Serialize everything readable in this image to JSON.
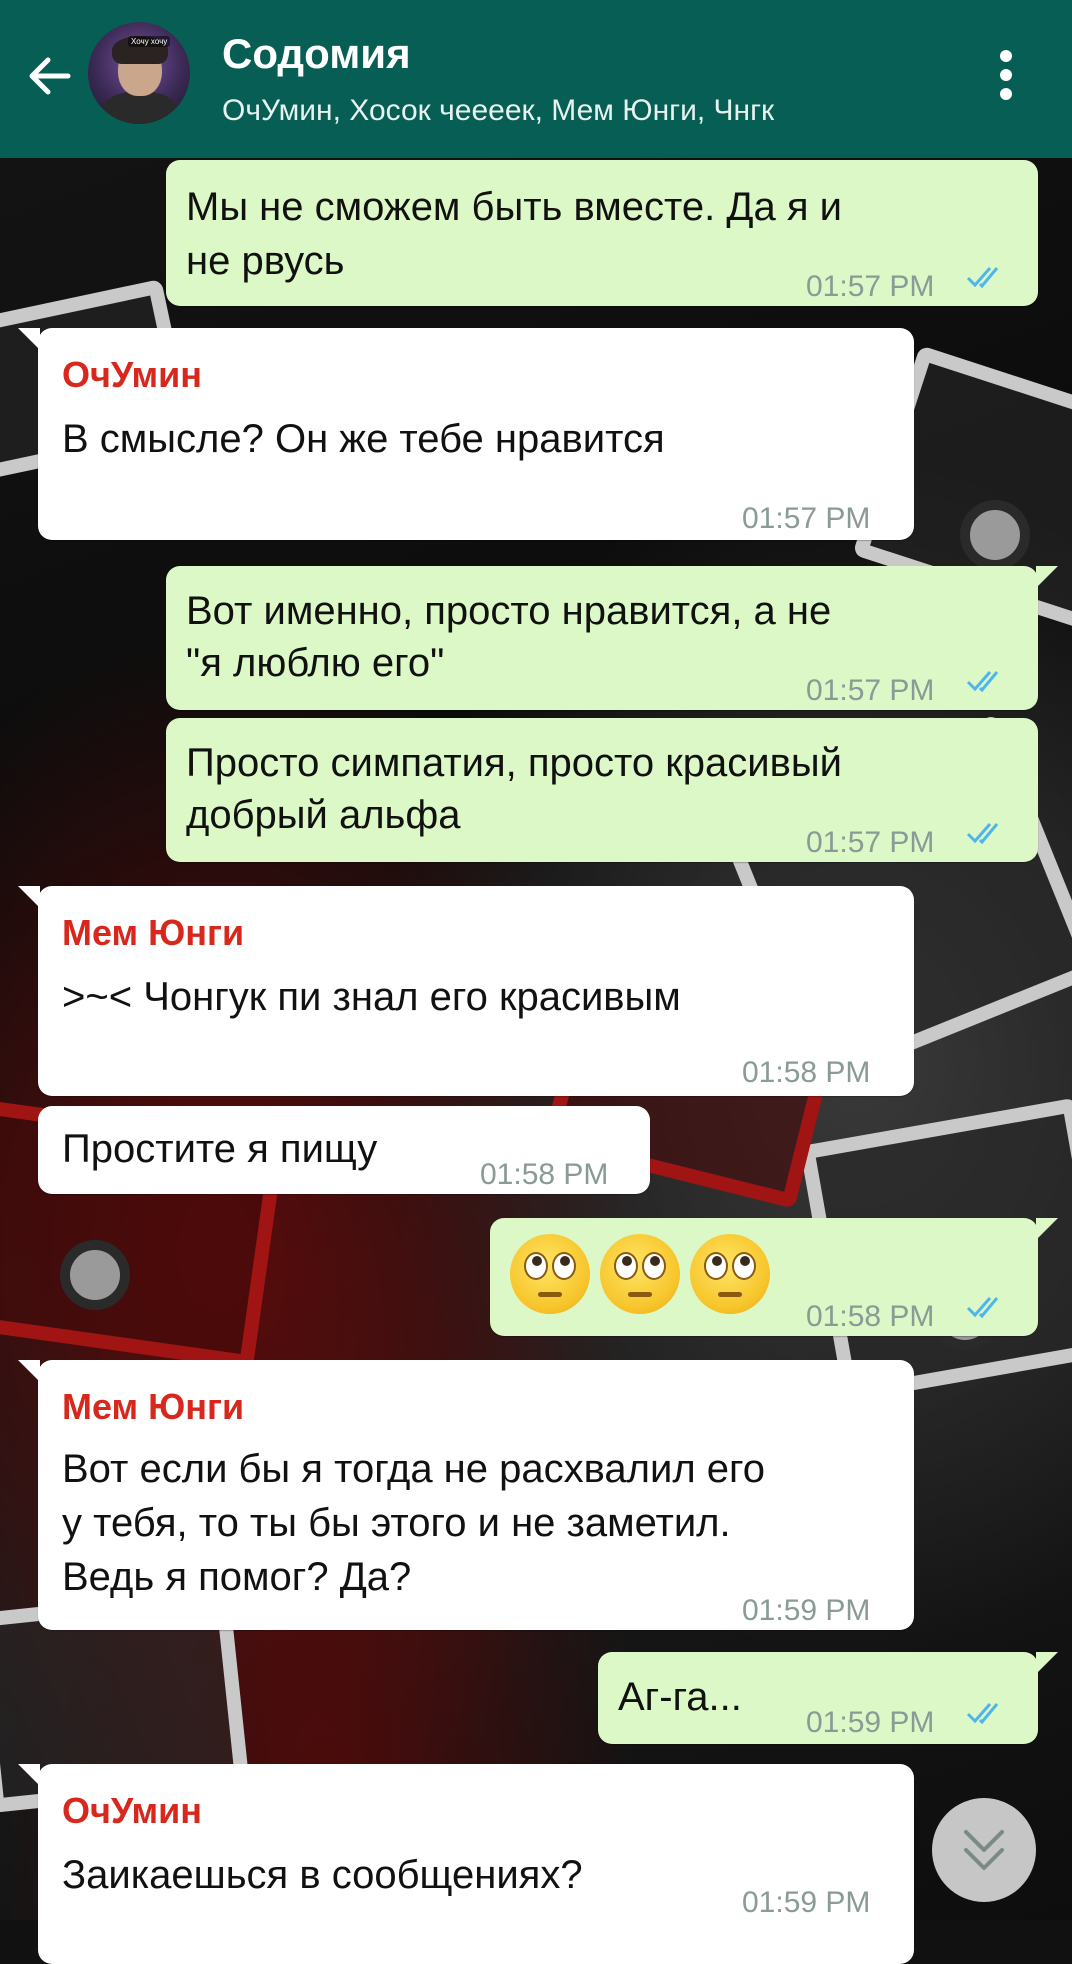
{
  "header": {
    "title": "Содомия",
    "subtitle": "ОчУмин, Хосок чееeeк, Мем Юнги, Чнгк",
    "avatar_tag": "Хочу хочу"
  },
  "messages": [
    {
      "dir": "out",
      "lines": [
        "Мы не сможем быть вместе. Да я и",
        "не рвусь"
      ],
      "time": "01:57 PM",
      "read": true
    },
    {
      "dir": "in",
      "sender": "ОчУмин",
      "lines": [
        "В смысле? Он же тебе нравится"
      ],
      "time": "01:57 PM"
    },
    {
      "dir": "out",
      "lines": [
        "Вот именно, просто нравится, а не",
        "\"я люблю его\""
      ],
      "time": "01:57 PM",
      "read": true
    },
    {
      "dir": "out",
      "lines": [
        "Просто симпатия, просто красивый",
        "добрый альфа"
      ],
      "time": "01:57 PM",
      "read": true
    },
    {
      "dir": "in",
      "sender": "Мем Юнги",
      "lines": [
        ">~< Чонгук пи знал его красивым"
      ],
      "time": "01:58 PM"
    },
    {
      "dir": "in",
      "lines": [
        "Простите я пищу"
      ],
      "time": "01:58 PM"
    },
    {
      "dir": "out",
      "emoji": "face-with-rolling-eyes x3",
      "time": "01:58 PM",
      "read": true
    },
    {
      "dir": "in",
      "sender": "Мем Юнги",
      "lines": [
        "Вот если бы я тогда не расхвалил его",
        "у тебя, то ты бы этого и не заметил.",
        "Ведь я помог? Да?"
      ],
      "time": "01:59 PM"
    },
    {
      "dir": "out",
      "lines": [
        "Аг-га..."
      ],
      "time": "01:59 PM",
      "read": true
    },
    {
      "dir": "in",
      "sender": "ОчУмин",
      "lines": [
        "Заикаешься в сообщениях?"
      ],
      "time": "01:59 PM"
    }
  ],
  "colors": {
    "header": "#075e54",
    "outgoing": "#dcf8c6",
    "incoming": "#ffffff",
    "sender_name": "#d8281d",
    "read_ticks": "#4fb6ec"
  },
  "icons": {
    "back": "arrow-left-icon",
    "menu": "vertical-dots-icon",
    "scroll": "double-chevron-down-icon",
    "ticks": "double-check-icon"
  }
}
